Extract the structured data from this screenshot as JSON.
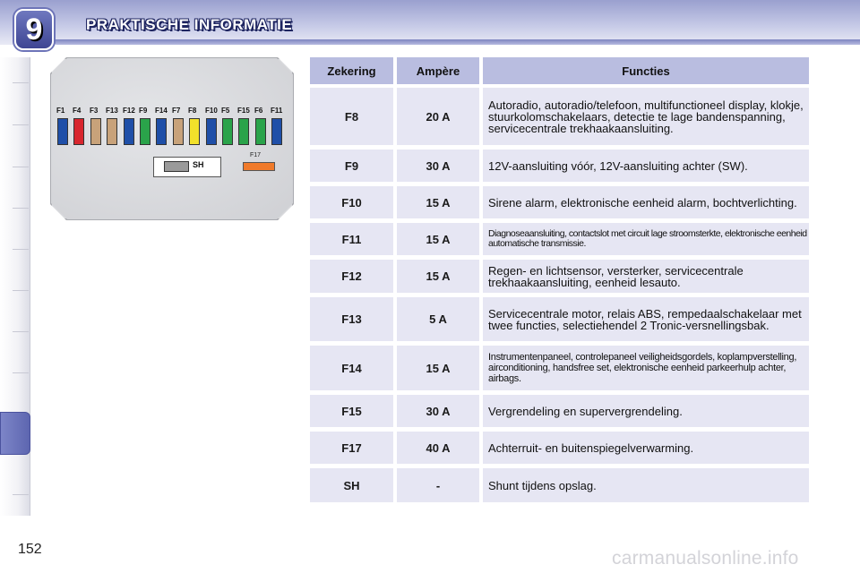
{
  "header": {
    "chapter_number": "9",
    "title": "PRAKTISCHE INFORMATIE"
  },
  "page_number": "152",
  "watermark": "carmanualsonline.info",
  "diagram": {
    "fuses": [
      {
        "label": "F1",
        "color": "#1f4fa8"
      },
      {
        "label": "F4",
        "color": "#d8262e"
      },
      {
        "label": "F3",
        "color": "#c8a27a"
      },
      {
        "label": "F13",
        "color": "#c8a27a"
      },
      {
        "label": "F12",
        "color": "#1f4fa8"
      },
      {
        "label": "F9",
        "color": "#2aa34a"
      },
      {
        "label": "F14",
        "color": "#1f4fa8"
      },
      {
        "label": "F7",
        "color": "#c8a27a"
      },
      {
        "label": "F8",
        "color": "#f2e12b"
      },
      {
        "label": "F10",
        "color": "#1f4fa8"
      },
      {
        "label": "F5",
        "color": "#2aa34a"
      },
      {
        "label": "F15",
        "color": "#2aa34a"
      },
      {
        "label": "F6",
        "color": "#2aa34a"
      },
      {
        "label": "F11",
        "color": "#1f4fa8"
      }
    ],
    "f17_label": "F17",
    "f17_color": "#f07a2a",
    "sh_label": "SH"
  },
  "table": {
    "headers": {
      "fuse": "Zekering",
      "amp": "Ampère",
      "functions": "Functies"
    },
    "rows": [
      {
        "fuse": "F8",
        "amp": "20 A",
        "functions": "Autoradio, autoradio/telefoon, multifunctioneel display, klokje, stuurkolomschakelaars, detectie te lage bandenspanning, servicecentrale trekhaakaansluiting."
      },
      {
        "fuse": "F9",
        "amp": "30 A",
        "functions": "12V-aansluiting vóór, 12V-aansluiting achter (SW)."
      },
      {
        "fuse": "F10",
        "amp": "15 A",
        "functions": "Sirene alarm, elektronische eenheid alarm, bochtverlichting."
      },
      {
        "fuse": "F11",
        "amp": "15 A",
        "functions": "Diagnoseaansluiting, contactslot met circuit lage stroomsterkte, elektronische eenheid automatische transmissie."
      },
      {
        "fuse": "F12",
        "amp": "15 A",
        "functions": "Regen- en lichtsensor, versterker, servicecentrale trekhaakaansluiting, eenheid lesauto."
      },
      {
        "fuse": "F13",
        "amp": "5 A",
        "functions": "Servicecentrale motor, relais ABS, rempedaalschakelaar met twee functies, selectiehendel 2 Tronic-versnellingsbak."
      },
      {
        "fuse": "F14",
        "amp": "15 A",
        "functions": "Instrumentenpaneel, controlepaneel veiligheidsgordels, koplampverstelling, airconditioning, handsfree set, elektronische eenheid parkeerhulp achter, airbags."
      },
      {
        "fuse": "F15",
        "amp": "30 A",
        "functions": "Vergrendeling en supervergrendeling."
      },
      {
        "fuse": "F17",
        "amp": "40 A",
        "functions": "Achterruit- en buitenspiegelverwarming."
      },
      {
        "fuse": "SH",
        "amp": "-",
        "functions": "Shunt tijdens opslag."
      }
    ]
  }
}
